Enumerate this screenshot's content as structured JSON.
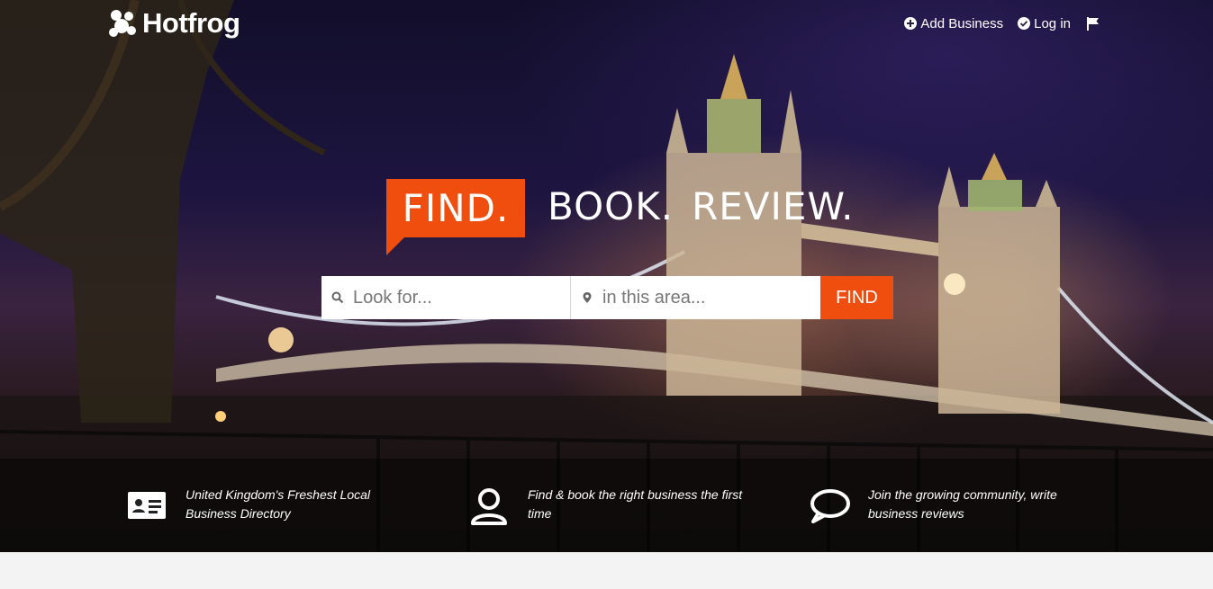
{
  "brand": {
    "name": "Hotfrog"
  },
  "nav": {
    "add_business": "Add Business",
    "login": "Log in",
    "icons": {
      "add": "plus-circle-icon",
      "login": "check-circle-icon",
      "flag": "flag-icon"
    }
  },
  "headline": {
    "word1": "FIND.",
    "word2": "BOOK.",
    "word3": "REVIEW."
  },
  "search": {
    "what_placeholder": "Look for...",
    "where_placeholder": "in this area...",
    "button_label": "FIND",
    "what_value": "",
    "where_value": ""
  },
  "features": [
    {
      "icon": "id-card-icon",
      "text": "United Kingdom's Freshest Local Business Directory"
    },
    {
      "icon": "user-icon",
      "text": "Find & book the right business the first time"
    },
    {
      "icon": "speech-bubble-icon",
      "text": "Join the growing community, write business reviews"
    }
  ],
  "colors": {
    "accent": "#f04e0f",
    "footer_bg": "#f3f3f3"
  }
}
